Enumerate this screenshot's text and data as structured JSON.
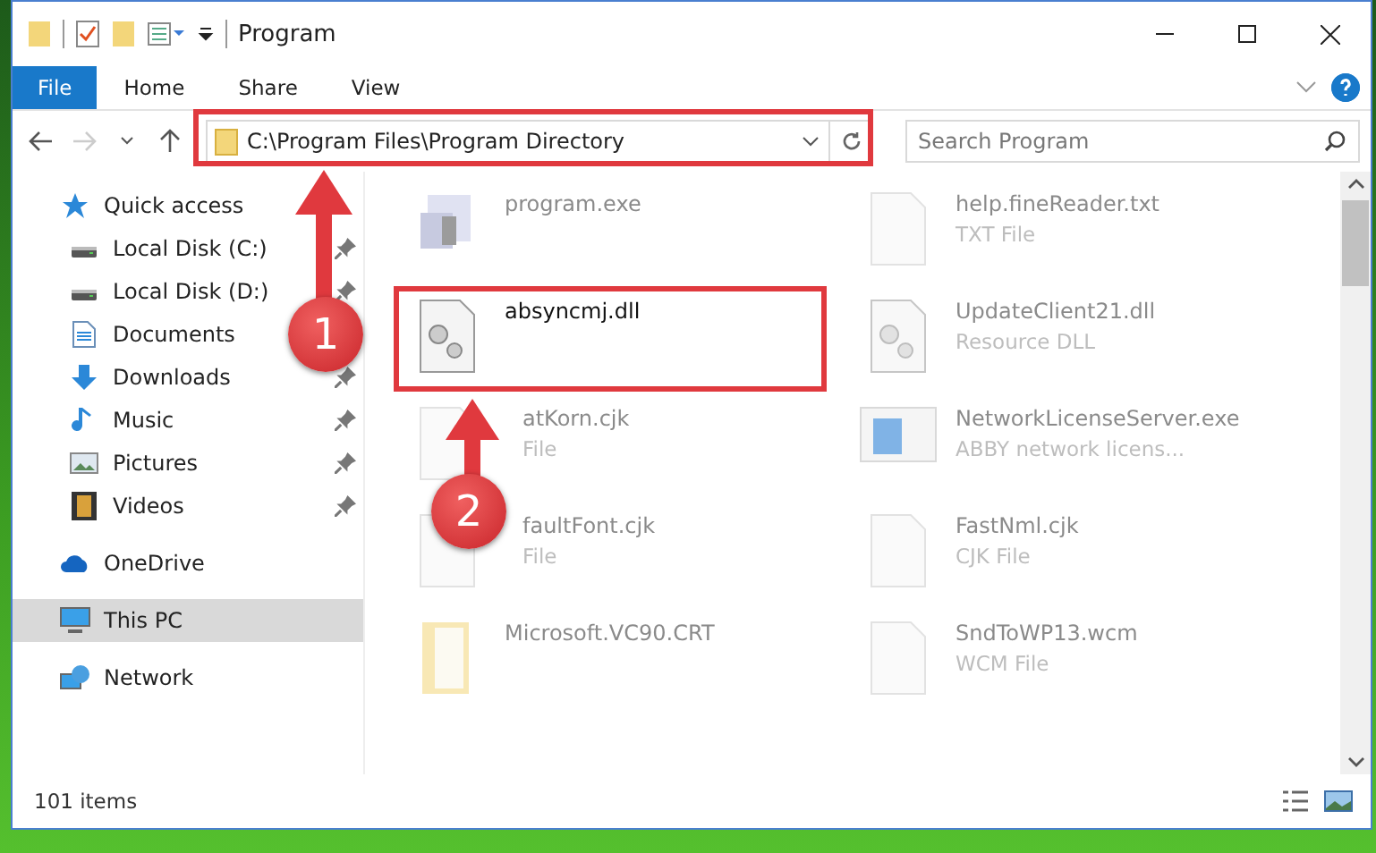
{
  "window": {
    "title": "Program"
  },
  "ribbon_tabs": [
    {
      "label": "File",
      "selected": true
    },
    {
      "label": "Home",
      "selected": false
    },
    {
      "label": "Share",
      "selected": false
    },
    {
      "label": "View",
      "selected": false
    }
  ],
  "address": {
    "value": "C:\\Program Files\\Program Directory"
  },
  "search": {
    "placeholder": "Search Program"
  },
  "navigation": [
    {
      "label": "Quick access",
      "kind": "star",
      "selected": false,
      "children": [
        {
          "label": "Local Disk (C:)",
          "kind": "drive",
          "selected": false
        },
        {
          "label": "Local Disk (D:)",
          "kind": "drive",
          "selected": false
        },
        {
          "label": "Documents",
          "kind": "document",
          "selected": false
        },
        {
          "label": "Downloads",
          "kind": "download",
          "selected": false
        },
        {
          "label": "Music",
          "kind": "music",
          "selected": false
        },
        {
          "label": "Pictures",
          "kind": "picture",
          "selected": false
        },
        {
          "label": "Videos",
          "kind": "video",
          "selected": false
        }
      ]
    },
    {
      "label": "OneDrive",
      "kind": "cloud",
      "selected": false
    },
    {
      "label": "This PC",
      "kind": "computer",
      "selected": true
    },
    {
      "label": "Network",
      "kind": "network",
      "selected": false
    }
  ],
  "files": [
    {
      "name": "program.exe",
      "kind": "app",
      "blurred": true
    },
    {
      "name": "help.fineReader.txt",
      "type": "TXT File",
      "kind": "blank",
      "blurred": true
    },
    {
      "name": "absyncmj.dll",
      "kind": "gear",
      "blurred": false
    },
    {
      "name": "UpdateClient21.dll",
      "type": "Resource DLL",
      "kind": "gear",
      "blurred": true
    },
    {
      "name": "atKorn.cjk",
      "type": "File",
      "kind": "blank",
      "blurred": true
    },
    {
      "name": "NetworkLicenseServer.exe",
      "type": "ABBY network licens...",
      "kind": "window",
      "blurred": true
    },
    {
      "name": "faultFont.cjk",
      "type": "File",
      "kind": "blank",
      "blurred": true
    },
    {
      "name": "FastNml.cjk",
      "type": "CJK File",
      "kind": "blank",
      "blurred": true
    },
    {
      "name": "Microsoft.VC90.CRT",
      "kind": "folder",
      "blurred": true
    },
    {
      "name": "SndToWP13.wcm",
      "type": "WCM File",
      "kind": "blank",
      "blurred": true
    }
  ],
  "status_bar": {
    "item_count": "101 items"
  },
  "annotations": [
    {
      "label": "1"
    },
    {
      "label": "2"
    }
  ]
}
